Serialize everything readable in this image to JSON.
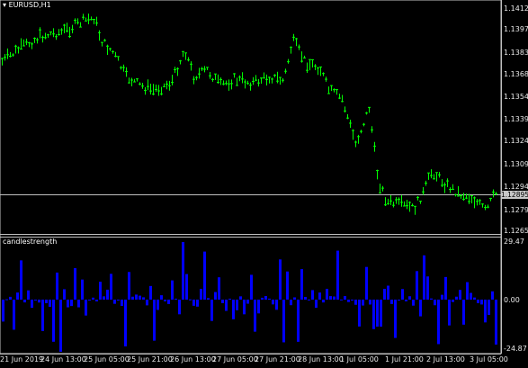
{
  "chart": {
    "symbol": "EURUSD,H1",
    "indicator_name": "candlestrength",
    "current_price": "1.12895",
    "price_axis": [
      "1.14120",
      "1.13975",
      "1.13830",
      "1.13685",
      "1.13540",
      "1.13395",
      "1.13245",
      "1.13095",
      "1.12945",
      "1.12795",
      "1.12650"
    ],
    "indicator_axis": [
      "29.47",
      "0.00",
      "-24.87"
    ],
    "time_axis": [
      "21 Jun 2019",
      "24 Jun 13:00",
      "25 Jun 05:00",
      "25 Jun 21:00",
      "26 Jun 13:00",
      "27 Jun 05:00",
      "27 Jun 21:00",
      "28 Jun 13:00",
      "1 Jul 05:00",
      "1 Jul 21:00",
      "2 Jul 13:00",
      "3 Jul 05:00"
    ],
    "colors": {
      "background": "#000000",
      "candle": "#00ff00",
      "histogram": "#0000ff",
      "grid": "#c0c0c0",
      "text": "#ffffff"
    }
  }
}
